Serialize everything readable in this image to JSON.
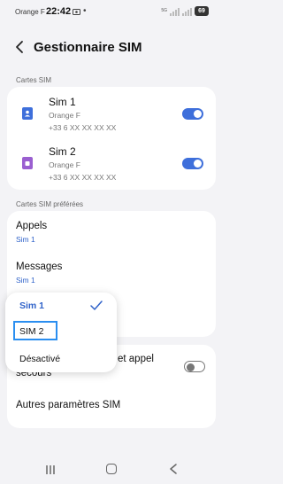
{
  "status_bar": {
    "carrier": "Orange F",
    "time": "22:42",
    "battery": "69",
    "network": "5G"
  },
  "header": {
    "title": "Gestionnaire SIM"
  },
  "sections": {
    "sim_cards": "Cartes SIM",
    "preferred": "Cartes SIM préférées"
  },
  "sims": [
    {
      "name": "Sim 1",
      "carrier": "Orange F",
      "number": "+33 6 XX XX XX XX",
      "enabled": true,
      "color": "#3e6fdb"
    },
    {
      "name": "SIM 2",
      "display_name": "Sim 2",
      "carrier": "Orange F",
      "number": "+33 6 XX XX XX XX",
      "enabled": true,
      "color": "#9a5fd0"
    }
  ],
  "preferred": {
    "calls": {
      "label": "Appels",
      "value": "Sim 1"
    },
    "messages": {
      "label": "Messages",
      "value": "Sim 1"
    }
  },
  "dropdown": {
    "options": [
      "Sim 1",
      "SIM 2",
      "Désactivé"
    ],
    "selected": "Sim 1",
    "highlighted": "SIM 2"
  },
  "more": {
    "emergency_label_line1": "et appel",
    "emergency_label_line2": "secours",
    "emergency_enabled": false,
    "other_settings": "Autres paramètres SIM"
  },
  "colors": {
    "accent": "#3e6fdb",
    "background": "#f3f3f6",
    "highlight_box": "#2a8ef0"
  }
}
